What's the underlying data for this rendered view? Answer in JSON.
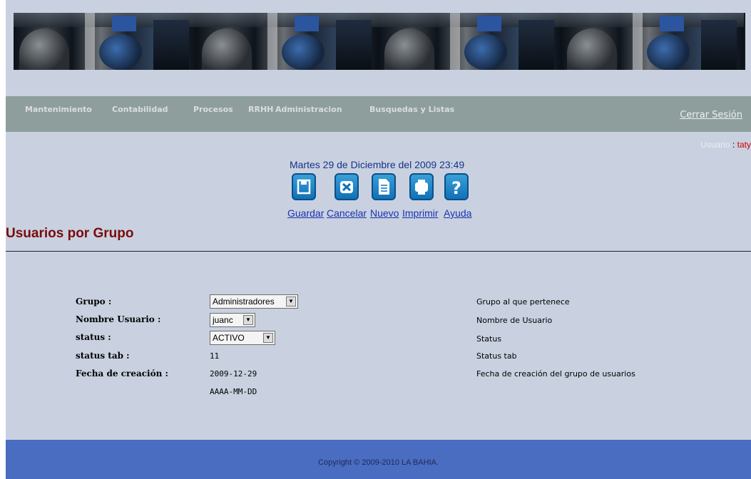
{
  "nav": {
    "items": [
      "Mantenimiento",
      "Contabilidad",
      "Procesos",
      "RRHH",
      "Administracion",
      "Busquedas y Listas"
    ],
    "logout": "Cerrar Sesión"
  },
  "user": {
    "label": "Usuario",
    "separator": " : ",
    "name": "taty"
  },
  "date": "Martes 29 de Diciembre del 2009 23:49",
  "toolbar": {
    "save": "Guardar",
    "cancel": "Cancelar",
    "new": "Nuevo",
    "print": "Imprimir",
    "help": "Ayuda"
  },
  "page_title": "Usuarios por Grupo",
  "form": {
    "group": {
      "label": "Grupo :",
      "value": "Administradores",
      "desc": "Grupo al que pertenece"
    },
    "username": {
      "label": "Nombre Usuario :",
      "value": "juanc",
      "desc": "Nombre de Usuario"
    },
    "status": {
      "label": "status :",
      "value": "ACTIVO",
      "desc": "Status"
    },
    "status_tab": {
      "label": "status tab :",
      "value": "11",
      "desc": "Status tab"
    },
    "created": {
      "label": "Fecha de creación :",
      "value": "2009-12-29",
      "hint": "AAAA-MM-DD",
      "desc": "Fecha de creación del grupo de usuarios"
    }
  },
  "footer": "Copyright © 2009-2010 LA BAHIA.",
  "colors": {
    "nav_bg": "#8e9e9c",
    "page_bg": "#c9d1e0",
    "footer_bg": "#4a6cc1",
    "title": "#7a0b0b"
  }
}
